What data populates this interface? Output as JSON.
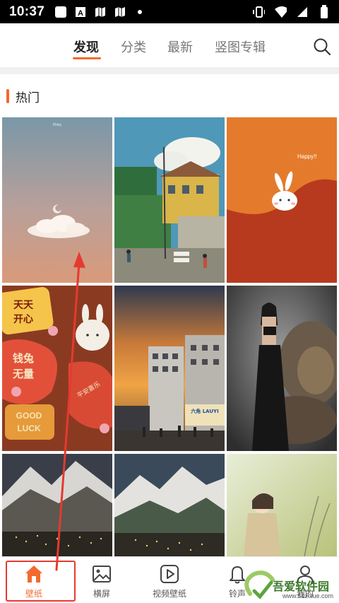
{
  "status_bar": {
    "time": "10:37",
    "icons_left": [
      "app-square-icon",
      "a-icon",
      "map-icon",
      "map-icon",
      "dot-icon"
    ],
    "icons_right": [
      "vibrate-icon",
      "wifi-icon",
      "signal-icon",
      "battery-icon"
    ]
  },
  "header": {
    "tabs": [
      {
        "label": "发现",
        "active": true
      },
      {
        "label": "分类",
        "active": false
      },
      {
        "label": "最新",
        "active": false
      },
      {
        "label": "竖图专辑",
        "active": false
      }
    ],
    "search_icon": "search-icon",
    "accent": "#f26a2e"
  },
  "section": {
    "title": "热门"
  },
  "wallpapers": [
    {
      "name": "pink-sky-cloud",
      "caption": "Pinky"
    },
    {
      "name": "village-street",
      "caption": ""
    },
    {
      "name": "orange-bunny",
      "caption": "Happy!!"
    },
    {
      "name": "rabbit-stickers",
      "caption": "天天开心 钱兔无量 GOOD LUCK"
    },
    {
      "name": "sunset-town",
      "caption": "六角 LAUYI"
    },
    {
      "name": "woman-lion",
      "caption": ""
    },
    {
      "name": "mountain-village-night",
      "caption": ""
    },
    {
      "name": "mountain-valley",
      "caption": ""
    },
    {
      "name": "anime-girl",
      "caption": ""
    }
  ],
  "bottom_nav": [
    {
      "label": "壁纸",
      "icon": "home-icon",
      "active": true
    },
    {
      "label": "横屏",
      "icon": "image-icon",
      "active": false
    },
    {
      "label": "视频壁纸",
      "icon": "play-icon",
      "active": false
    },
    {
      "label": "铃声",
      "icon": "bell-icon",
      "active": false
    },
    {
      "label": "我的",
      "icon": "user-icon",
      "active": false
    }
  ],
  "watermark": {
    "text": "吾爱软件园",
    "url": "www.52zixue.com"
  },
  "annotation_color": "#e53a2f"
}
